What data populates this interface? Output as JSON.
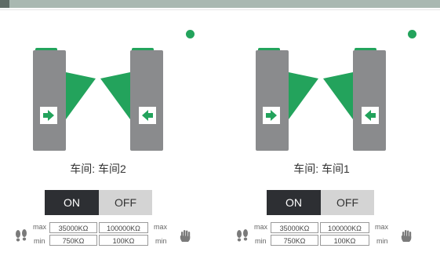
{
  "colors": {
    "accent": "#23a35c",
    "pillar": "#8a8b8d",
    "dark": "#2d2f33",
    "topbar": "#a9b8b1"
  },
  "panels": [
    {
      "channel_label": "车间: 车间2",
      "toggle": {
        "on_label": "ON",
        "off_label": "OFF",
        "active": "ON"
      },
      "limits": {
        "max_label": "max",
        "min_label": "min",
        "max_label_right": "max",
        "min_label_right": "min",
        "max_left": "35000KΩ",
        "max_right": "100000KΩ",
        "min_left": "750KΩ",
        "min_right": "100KΩ"
      },
      "icons": {
        "status": "status-dot-icon",
        "left_arrow": "enter-arrow-icon",
        "right_arrow": "exit-arrow-icon",
        "feet": "footprints-icon",
        "hand": "hand-icon"
      }
    },
    {
      "channel_label": "车间: 车间1",
      "toggle": {
        "on_label": "ON",
        "off_label": "OFF",
        "active": "ON"
      },
      "limits": {
        "max_label": "max",
        "min_label": "min",
        "max_label_right": "max",
        "min_label_right": "min",
        "max_left": "35000KΩ",
        "max_right": "100000KΩ",
        "min_left": "750KΩ",
        "min_right": "100KΩ"
      },
      "icons": {
        "status": "status-dot-icon",
        "left_arrow": "enter-arrow-icon",
        "right_arrow": "exit-arrow-icon",
        "feet": "footprints-icon",
        "hand": "hand-icon"
      }
    }
  ]
}
